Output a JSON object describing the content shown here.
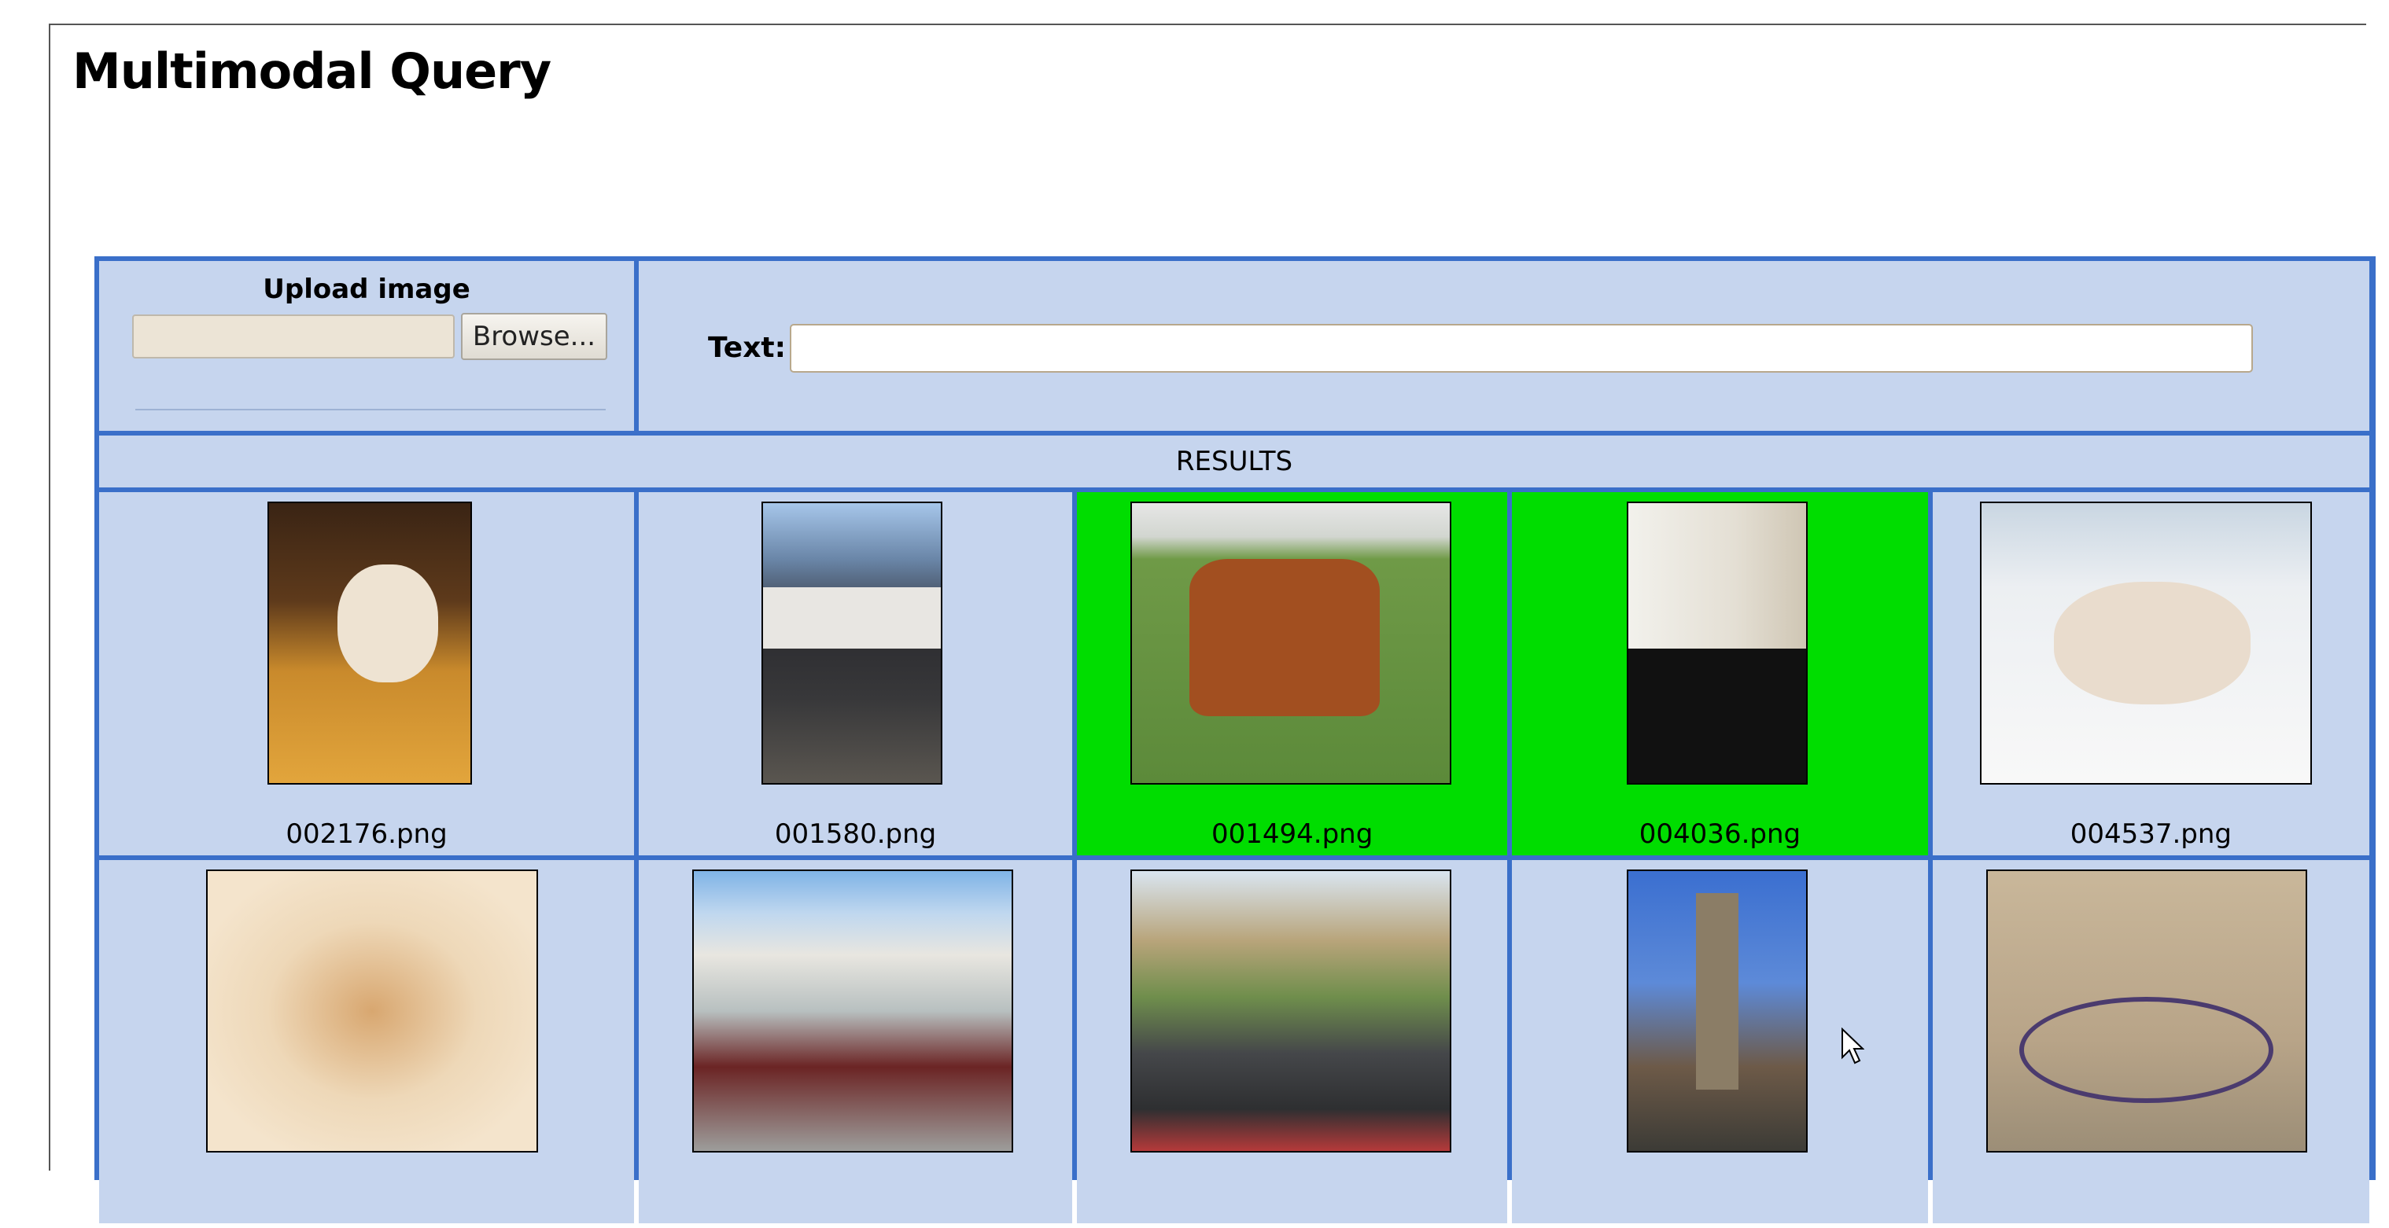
{
  "page": {
    "title": "Multimodal Query"
  },
  "upload": {
    "label": "Upload image",
    "browse_label": "Browse...",
    "file_value": ""
  },
  "text_query": {
    "label": "Text:",
    "value": ""
  },
  "results": {
    "header": "RESULTS",
    "highlight_color": "#00dd00",
    "row1": [
      {
        "filename": "002176.png",
        "highlighted": false
      },
      {
        "filename": "001580.png",
        "highlighted": false
      },
      {
        "filename": "001494.png",
        "highlighted": true
      },
      {
        "filename": "004036.png",
        "highlighted": true
      },
      {
        "filename": "004537.png",
        "highlighted": false
      }
    ],
    "row2": [
      {
        "filename": "",
        "highlighted": false
      },
      {
        "filename": "",
        "highlighted": false
      },
      {
        "filename": "",
        "highlighted": false
      },
      {
        "filename": "",
        "highlighted": false
      },
      {
        "filename": "",
        "highlighted": false
      }
    ]
  },
  "colors": {
    "cell_background": "#c6d5ee",
    "grid_border": "#3a6fc9"
  }
}
